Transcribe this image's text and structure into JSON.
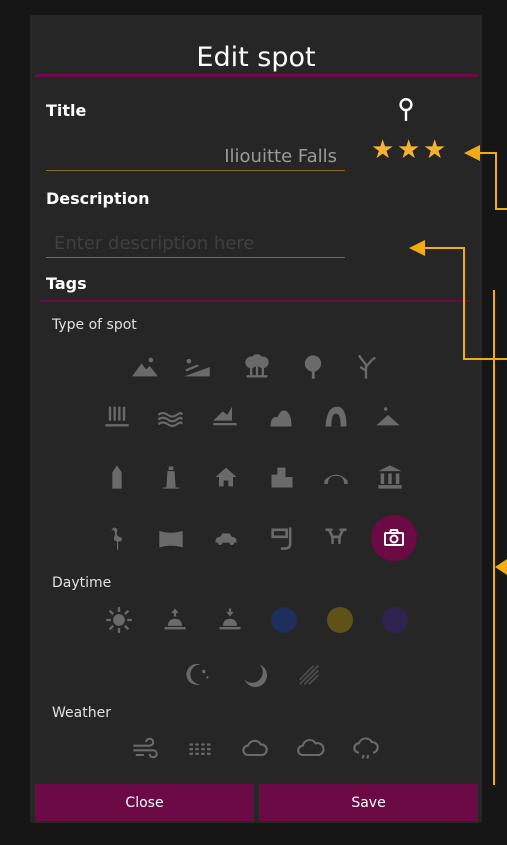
{
  "header": {
    "title": "Edit spot"
  },
  "form": {
    "title_label": "Title",
    "title_value": "Iliouitte Falls",
    "description_label": "Description",
    "description_placeholder": "Enter description here",
    "tags_label": "Tags",
    "rating": {
      "value": 3,
      "max": 3
    }
  },
  "sections": {
    "type_label": "Type of spot",
    "daytime_label": "Daytime",
    "weather_label": "Weather"
  },
  "type_icons": [
    "mountains-icon",
    "fields-icon",
    "forest-icon",
    "tree-icon",
    "dead-tree-icon",
    "waterfall-icon",
    "water-icon",
    "coast-icon",
    "rock-icon",
    "arch-icon",
    "hill-icon",
    "tower-icon",
    "lighthouse-icon",
    "house-icon",
    "city-icon",
    "bridge-icon",
    "monument-icon",
    "flamingo-icon",
    "landscape-icon",
    "car-icon",
    "snorkel-icon",
    "drone-icon",
    "camera-icon"
  ],
  "daytime_icons": [
    "sun-icon",
    "sunrise-icon",
    "sunset-icon",
    "blue-hour-icon",
    "golden-hour-icon",
    "twilight-icon"
  ],
  "night_icons": [
    "night-stars-icon",
    "moon-icon",
    "meteor-icon"
  ],
  "weather_icons": [
    "wind-icon",
    "fog-icon",
    "cloud-icon",
    "cloudy-icon",
    "rain-cloud-icon"
  ],
  "buttons": {
    "close": "Close",
    "save": "Save"
  },
  "colors": {
    "accent": "#6b0a45",
    "star": "#f2b233",
    "arrow": "#f2ab11",
    "blue_hour": "#1d2f5c",
    "golden_hour": "#5e5218",
    "twilight": "#2f2352"
  }
}
